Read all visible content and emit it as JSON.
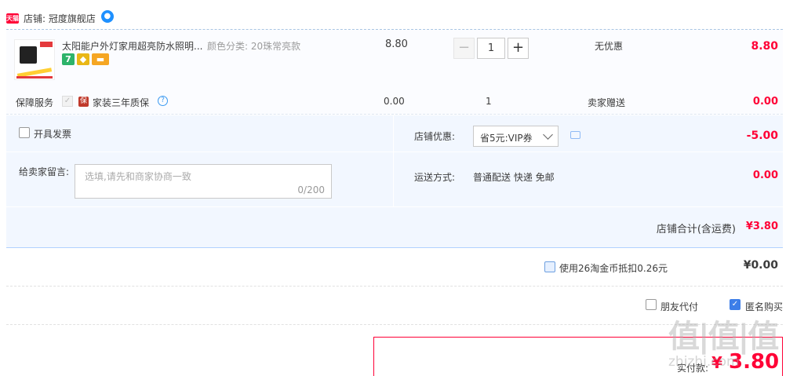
{
  "shop": {
    "badge": "天猫",
    "label": "店铺: 冠度旗舰店",
    "chat_icon": "wangwang-icon"
  },
  "item": {
    "title": "太阳能户外灯家用超亮防水照明...",
    "sku": "颜色分类: 20珠常亮款",
    "unit_price": "8.80",
    "quantity": "1",
    "minus_label": "−",
    "plus_label": "+",
    "discount": "无优惠",
    "total": "8.80",
    "service_icons": [
      "seven-day-return-icon",
      "gold-seller-icon",
      "credit-card-icon"
    ]
  },
  "guarantee": {
    "label": "保障服务",
    "name": "家装三年质保",
    "price": "0.00",
    "quantity": "1",
    "gift": "卖家赠送",
    "total": "0.00"
  },
  "invoice": {
    "label": "开具发票"
  },
  "message": {
    "label": "给卖家留言:",
    "placeholder": "选填,请先和商家协商一致",
    "count": "0/200"
  },
  "store_discount": {
    "label": "店铺优惠:",
    "selected": "省5元:VIP券",
    "value": "-5.00"
  },
  "shipping": {
    "label": "运送方式:",
    "text": "普通配送 快递 免邮",
    "value": "0.00"
  },
  "store_total": {
    "label": "店铺合计(含运费)",
    "value": "¥3.80"
  },
  "coins": {
    "label": "使用26淘金币抵扣0.26元",
    "value": "¥0.00"
  },
  "friend_pay": {
    "label": "朋友代付"
  },
  "anonymous": {
    "label": "匿名购买",
    "checked": true
  },
  "pay": {
    "label": "实付款:",
    "yen": "¥",
    "value": "3.80"
  },
  "watermark": {
    "text": "值|值|值",
    "sub": "zhizhi.com"
  },
  "colors": {
    "accent_red": "#ff0036",
    "light_blue_bg": "#f2f7ff",
    "checkbox_blue": "#3d7ee8"
  }
}
